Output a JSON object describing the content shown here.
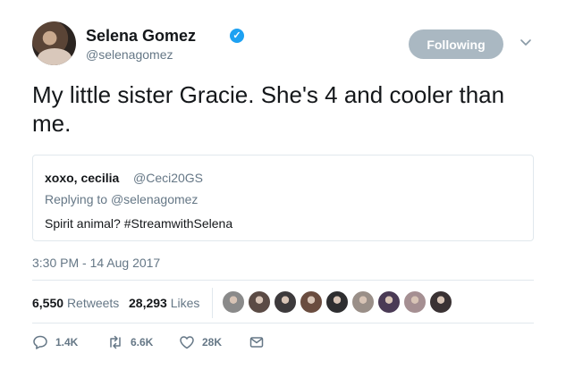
{
  "author": {
    "name": "Selena Gomez",
    "handle": "@selenagomez",
    "verified_icon": "verified-badge-icon",
    "follow_label": "Following"
  },
  "tweet": {
    "text": "My little sister Gracie. She's 4 and cooler than me.",
    "timestamp": "3:30 PM - 14 Aug 2017"
  },
  "quoted": {
    "name": "xoxo, cecilia",
    "handle": "@Ceci20GS",
    "replying_prefix": "Replying to ",
    "replying_to": "@selenagomez",
    "text": "Spirit animal? #StreamwithSelena"
  },
  "stats": {
    "retweets_count": "6,550",
    "retweets_label": "Retweets",
    "likes_count": "28,293",
    "likes_label": "Likes",
    "liker_avatars": [
      "#8a8a8a",
      "#5b4b45",
      "#3d3a3c",
      "#6a4c3f",
      "#2e2e30",
      "#9a8f88",
      "#4a3a55",
      "#a58f92",
      "#3a3234"
    ]
  },
  "actions": {
    "reply_count": "1.4K",
    "retweet_count": "6.6K",
    "like_count": "28K"
  },
  "colors": {
    "accent": "#1da1f2",
    "muted_text": "#657786",
    "following_button": "#aab8c2",
    "border": "#e1e8ed"
  }
}
